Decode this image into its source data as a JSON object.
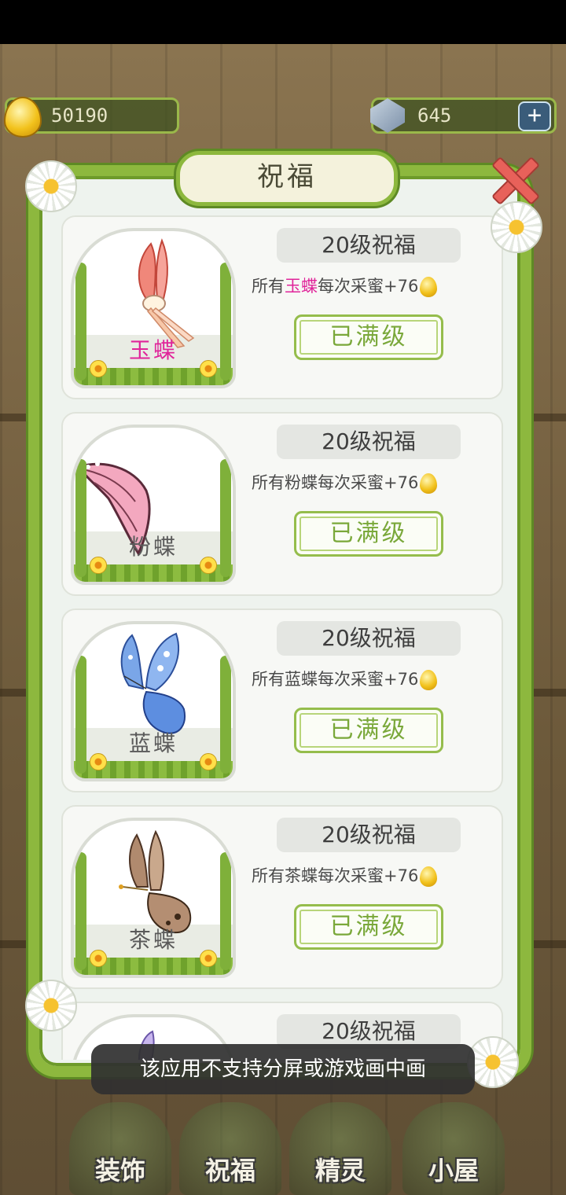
{
  "currency": {
    "honey": "50190",
    "gems": "645",
    "add_label": "+"
  },
  "panel": {
    "title": "祝福",
    "close_label": "✕"
  },
  "cards": [
    {
      "name": "玉蝶",
      "name_color": "#e0249a",
      "bless_title": "20级祝福",
      "desc_prefix": "所有",
      "desc_name": "玉蝶",
      "desc_name_color": "#e0249a",
      "desc_suffix": "每次采蜜+76",
      "button": "已满级"
    },
    {
      "name": "粉蝶",
      "name_color": "#5a5a5a",
      "bless_title": "20级祝福",
      "desc_prefix": "所有",
      "desc_name": "粉蝶",
      "desc_name_color": "#4a4a4a",
      "desc_suffix": "每次采蜜+76",
      "button": "已满级"
    },
    {
      "name": "蓝蝶",
      "name_color": "#5a5a5a",
      "bless_title": "20级祝福",
      "desc_prefix": "所有",
      "desc_name": "蓝蝶",
      "desc_name_color": "#4a4a4a",
      "desc_suffix": "每次采蜜+76",
      "button": "已满级"
    },
    {
      "name": "茶蝶",
      "name_color": "#5a5a5a",
      "bless_title": "20级祝福",
      "desc_prefix": "所有",
      "desc_name": "茶蝶",
      "desc_name_color": "#4a4a4a",
      "desc_suffix": "每次采蜜+76",
      "button": "已满级"
    },
    {
      "bless_title": "20级祝福"
    }
  ],
  "bottom_nav": [
    {
      "label": "装饰"
    },
    {
      "label": "祝福"
    },
    {
      "label": "精灵"
    },
    {
      "label": "小屋"
    }
  ],
  "toast": "该应用不支持分屏或游戏画中画",
  "colors": {
    "vine": "#8db83e",
    "button_text": "#7aa83a",
    "highlight": "#e0249a"
  }
}
